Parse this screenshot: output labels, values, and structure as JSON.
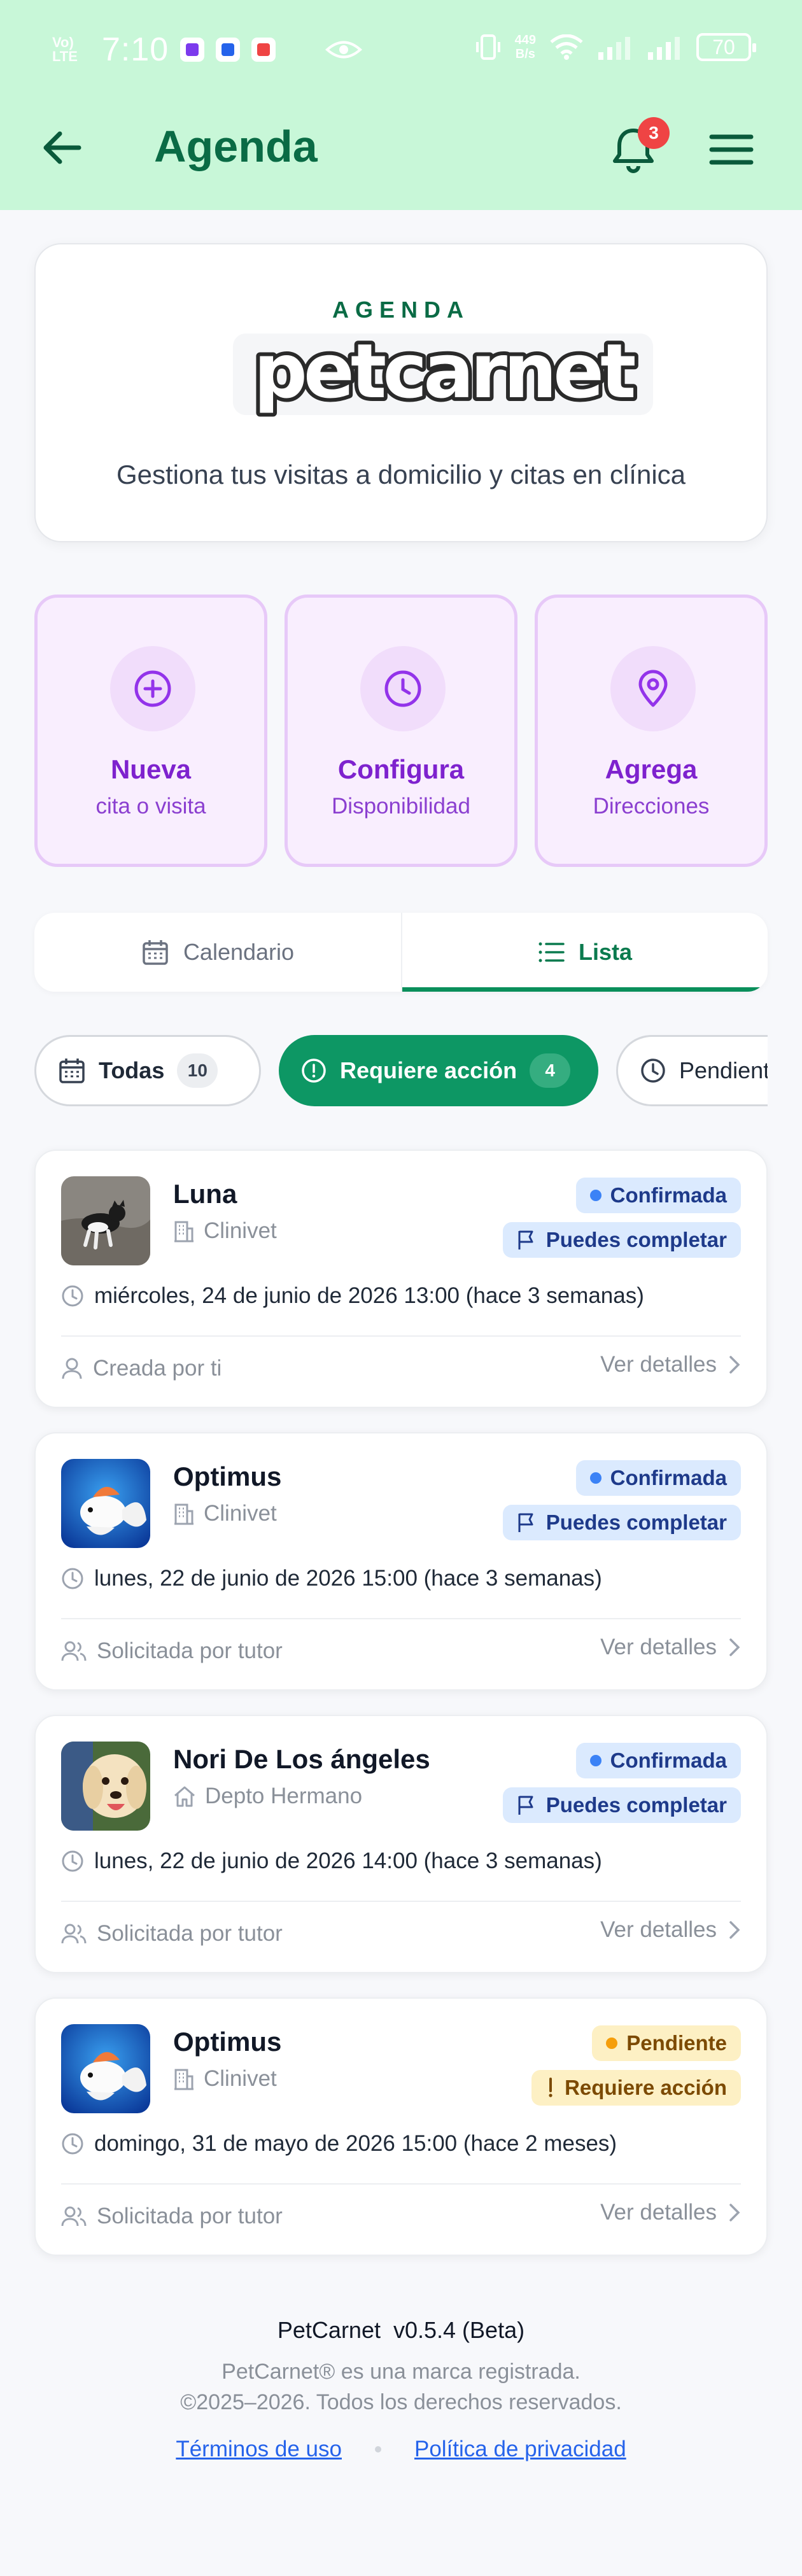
{
  "status_bar": {
    "volte_text": "Vo) LTE",
    "wifi_text": "WiFi",
    "time": "7:10",
    "speed_value": "449",
    "speed_unit": "B/s",
    "battery": "70"
  },
  "header": {
    "title": "Agenda",
    "notification_count": "3",
    "bg_color": "#c8f7d8",
    "accent": "#0a6b45"
  },
  "hero": {
    "kicker": "AGENDA",
    "logo_text": "petcarnet",
    "subtitle": "Gestiona tus visitas a domicilio y citas en clínica"
  },
  "actions": [
    {
      "title": "Nueva",
      "subtitle": "cita o visita",
      "icon": "plus-circle-icon"
    },
    {
      "title": "Configura",
      "subtitle": "Disponibilidad",
      "icon": "clock-icon"
    },
    {
      "title": "Agrega",
      "subtitle": "Direcciones",
      "icon": "map-pin-icon"
    }
  ],
  "view_toggle": {
    "calendar_label": "Calendario",
    "list_label": "Lista",
    "active": "Lista"
  },
  "filters": {
    "all_label": "Todas",
    "all_count": "10",
    "action_label": "Requiere acción",
    "action_count": "4",
    "pending_label": "Pendientes"
  },
  "appointments": [
    {
      "pet": "Luna",
      "place": "Clinivet",
      "place_icon": "building-icon",
      "status": "Confirmada",
      "tag": "Puedes completar",
      "date": "miércoles, 24 de junio de 2026 13:00 (hace 3 semanas)",
      "creator": "Creada por ti",
      "creator_icon": "user-icon",
      "details": "Ver detalles"
    },
    {
      "pet": "Optimus",
      "place": "Clinivet",
      "place_icon": "building-icon",
      "status": "Confirmada",
      "tag": "Puedes completar",
      "date": "lunes, 22 de junio de 2026 15:00 (hace 3 semanas)",
      "creator": "Solicitada por tutor",
      "creator_icon": "users-icon",
      "details": "Ver detalles"
    },
    {
      "pet": "Nori De Los ángeles",
      "place": "Depto Hermano",
      "place_icon": "home-icon",
      "status": "Confirmada",
      "tag": "Puedes completar",
      "date": "lunes, 22 de junio de 2026 14:00 (hace 3 semanas)",
      "creator": "Solicitada por tutor",
      "creator_icon": "users-icon",
      "details": "Ver detalles"
    },
    {
      "pet": "Optimus",
      "place": "Clinivet",
      "place_icon": "building-icon",
      "status": "Pendiente",
      "tag": "Requiere acción",
      "date": "domingo, 31 de mayo de 2026 15:00 (hace 2 meses)",
      "creator": "Solicitada por tutor",
      "creator_icon": "users-icon",
      "details": "Ver detalles"
    }
  ],
  "footer": {
    "version": "PetCarnet  v0.5.4 (Beta)",
    "trademark": "PetCarnet® es una marca registrada.",
    "copyright": "©2025–2026. Todos los derechos reservados.",
    "terms": "Términos de uso",
    "privacy": "Política de privacidad"
  }
}
